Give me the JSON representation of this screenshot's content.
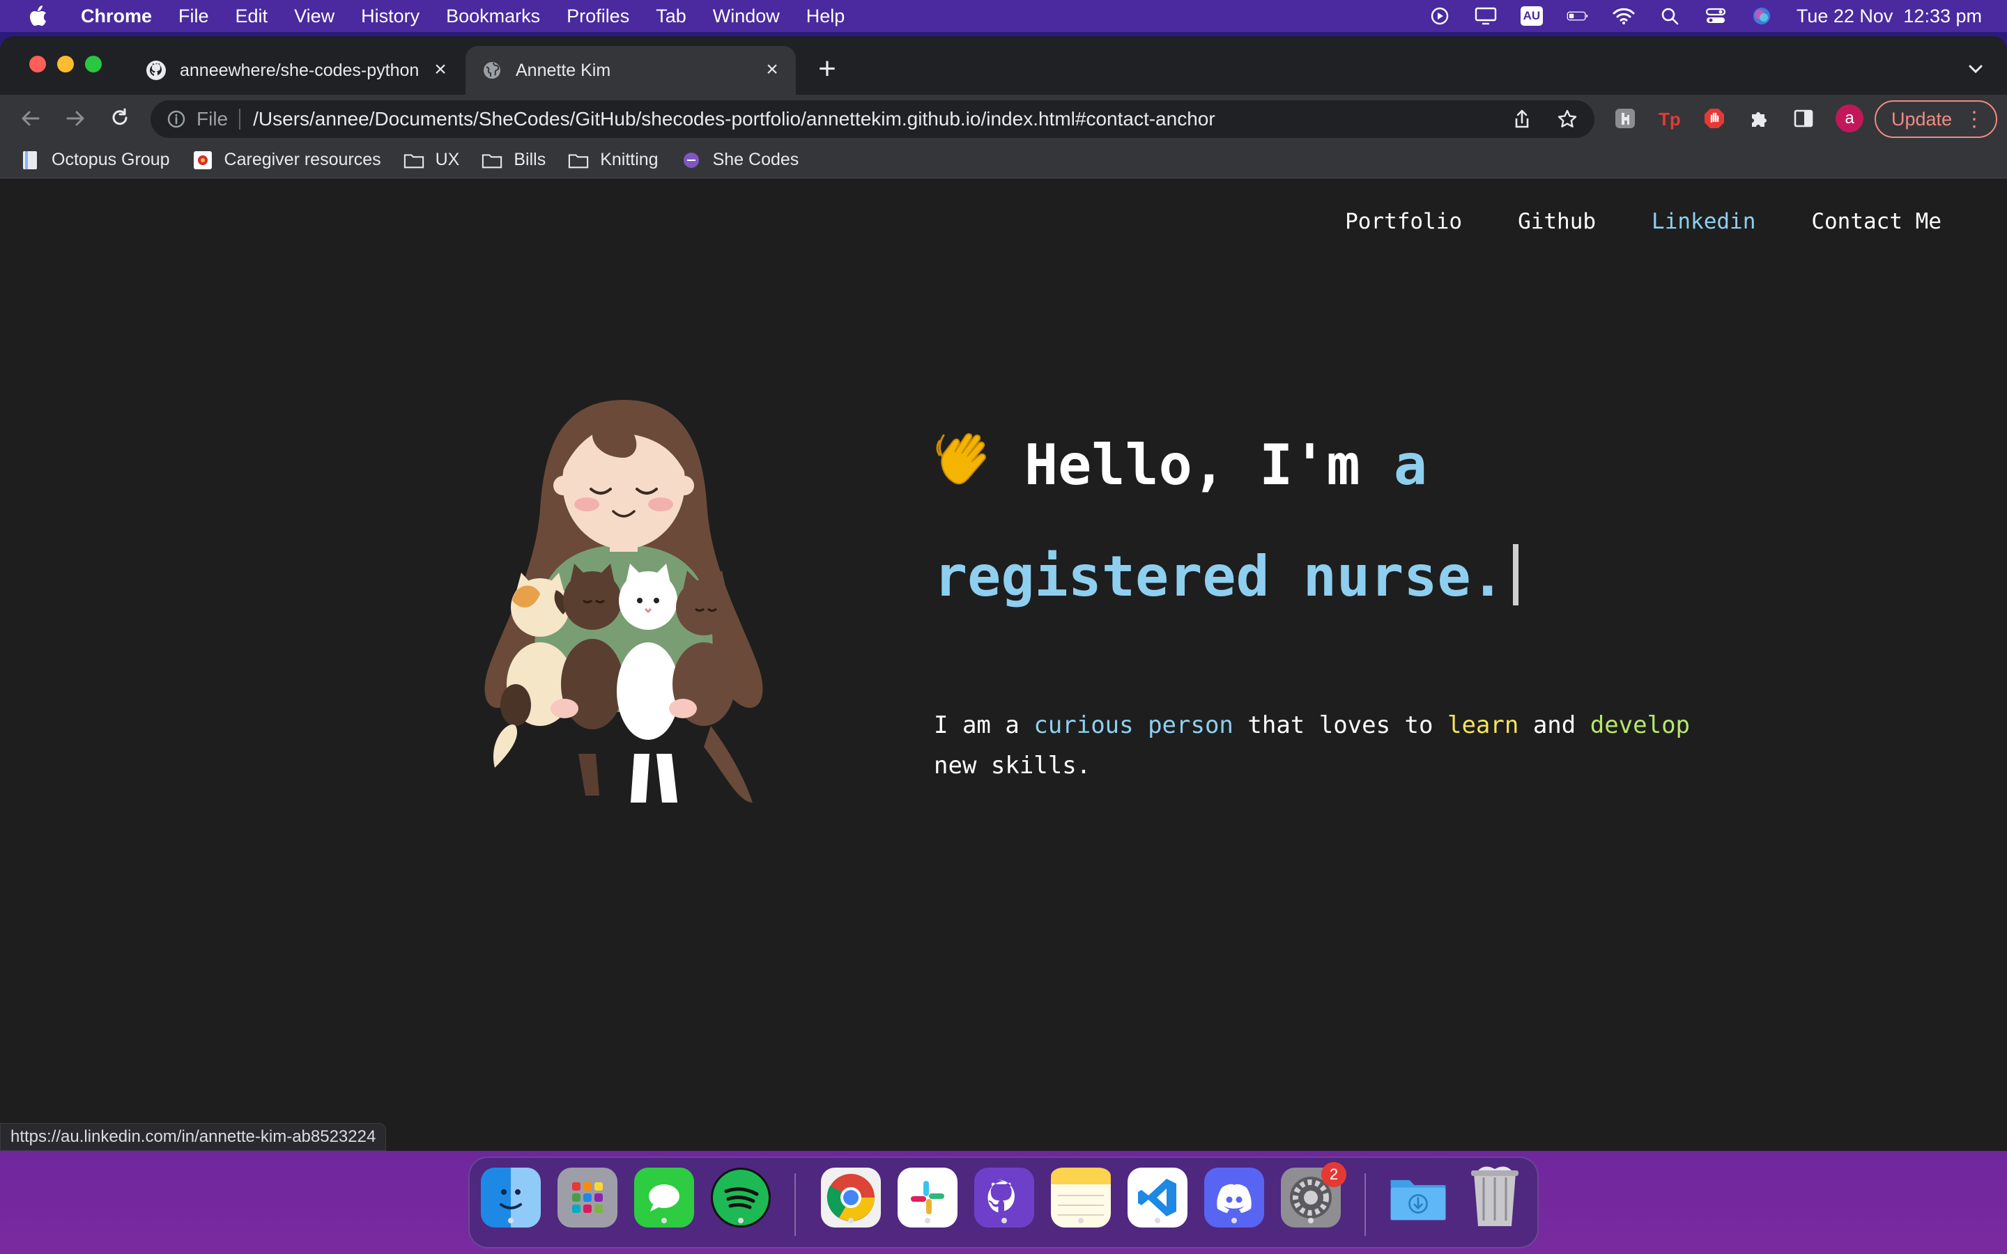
{
  "menubar": {
    "app_name": "Chrome",
    "items": [
      "File",
      "Edit",
      "View",
      "History",
      "Bookmarks",
      "Profiles",
      "Tab",
      "Window",
      "Help"
    ],
    "keyboard_badge": "AU",
    "datetime": "Tue 22 Nov  12:33 pm"
  },
  "browser": {
    "tabs": [
      {
        "title": "anneewhere/she-codes-python",
        "favicon": "github-icon"
      },
      {
        "title": "Annette Kim",
        "favicon": "globe-icon",
        "active": true
      }
    ],
    "scheme_label": "File",
    "url": "/Users/annee/Documents/SheCodes/GitHub/shecodes-portfolio/annettekim.github.io/index.html#contact-anchor",
    "profile_initial": "a",
    "update_label": "Update",
    "bookmarks": [
      {
        "label": "Octopus Group",
        "icon": "page-icon"
      },
      {
        "label": "Caregiver resources",
        "icon": "site-icon"
      },
      {
        "label": "UX",
        "icon": "folder-icon"
      },
      {
        "label": "Bills",
        "icon": "folder-icon"
      },
      {
        "label": "Knitting",
        "icon": "folder-icon"
      },
      {
        "label": "She Codes",
        "icon": "shecodes-icon"
      }
    ],
    "status_url": "https://au.linkedin.com/in/annette-kim-ab8523224"
  },
  "site": {
    "nav": [
      "Portfolio",
      "Github",
      "Linkedin",
      "Contact Me"
    ],
    "active_nav": "Linkedin",
    "hero": {
      "wave": "👋",
      "greeting": "Hello, I'm",
      "role_a": "a",
      "role": "registered nurse."
    },
    "intro": {
      "p1": "I am a",
      "curious": "curious person",
      "p2": "that loves to",
      "learn": "learn",
      "and": "and",
      "develop": "develop",
      "p3": "new skills."
    }
  },
  "dock": {
    "apps": [
      "Finder",
      "Launchpad",
      "Messages",
      "Spotify",
      "Chrome",
      "Slack",
      "GitHub Desktop",
      "Notes",
      "Visual Studio Code",
      "Discord",
      "System Preferences",
      "Downloads",
      "Trash"
    ],
    "system_prefs_badge": "2"
  },
  "colors": {
    "accent_blue": "#8ecff0",
    "highlight_yellow": "#f5e55a",
    "highlight_green": "#b6e86a",
    "page_bg": "#1e1e1e"
  }
}
